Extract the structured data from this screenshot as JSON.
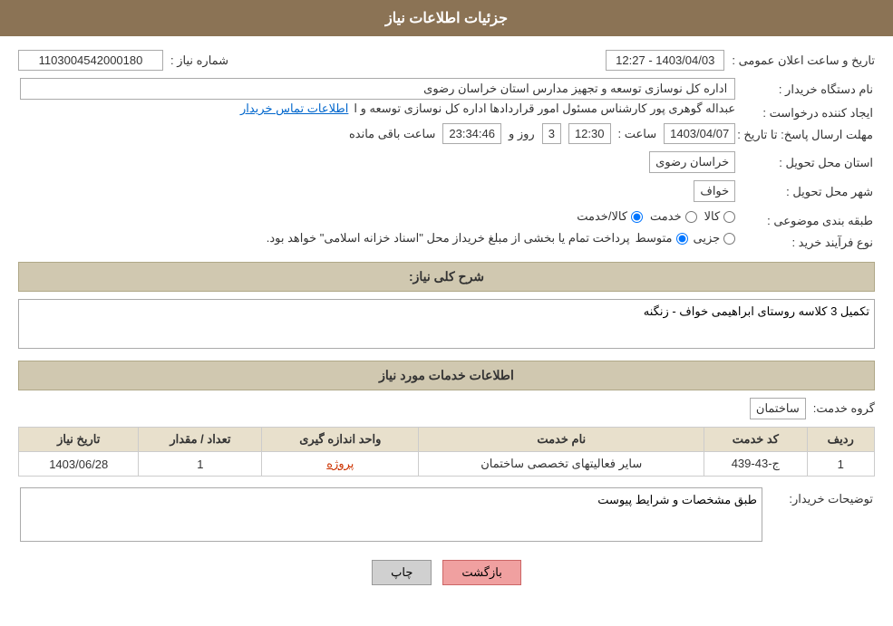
{
  "header": {
    "title": "جزئیات اطلاعات نیاز"
  },
  "fields": {
    "shomara_label": "شماره نیاز :",
    "shomara_value": "1103004542000180",
    "tarikh_label": "تاریخ و ساعت اعلان عمومی :",
    "tarikh_value": "1403/04/03 - 12:27",
    "nam_label": "نام دستگاه خریدار :",
    "nam_value": "اداره کل نوسازی  توسعه و تجهیز مدارس استان خراسان رضوی",
    "ejad_label": "ایجاد کننده درخواست :",
    "ejad_value": "عبداله گوهری پور کارشناس مسئول امور قراردادها  اداره کل نوسازی  توسعه و ا",
    "ejad_link": "اطلاعات تماس خریدار",
    "mohlat_label": "مهلت ارسال پاسخ: تا تاریخ :",
    "date_val": "1403/04/07",
    "saat_label": "ساعت :",
    "saat_val": "12:30",
    "roz_label": "روز و",
    "baqimande_val": "3",
    "saat_mande_val": "23:34:46",
    "saat_mande_label": "ساعت باقی مانده",
    "ostan_label": "استان محل تحویل :",
    "ostan_val": "خراسان رضوی",
    "shahr_label": "شهر محل تحویل :",
    "shahr_val": "خواف",
    "tabaqe_label": "طبقه بندی موضوعی :",
    "tabaqe_kala": "کالا",
    "tabaqe_khadamat": "خدمت",
    "tabaqe_kala_khadamat": "کالا/خدمت",
    "ferayand_label": "نوع فرآیند خرید :",
    "ferayand_jozi": "جزیی",
    "ferayand_motovaset": "متوسط",
    "ferayand_desc": "پرداخت تمام یا بخشی از مبلغ خریداز محل \"اسناد خزانه اسلامی\" خواهد بود.",
    "sharh_label": "شرح کلی نیاز:",
    "sharh_value": "تکمیل 3 کلاسه روستای ابراهیمی خواف - زنگنه",
    "services_header": "اطلاعات خدمات مورد نیاز",
    "gorohe_label": "گروه خدمت:",
    "gorohe_val": "ساختمان",
    "table_headers": [
      "ردیف",
      "کد خدمت",
      "نام خدمت",
      "واحد اندازه گیری",
      "تعداد / مقدار",
      "تاریخ نیاز"
    ],
    "table_rows": [
      {
        "radif": "1",
        "kod": "ج-43-439",
        "name": "سایر فعالیتهای تخصصی ساختمان",
        "vahad": "پروژه",
        "tedad": "1",
        "tarikh": "1403/06/28"
      }
    ],
    "tawzih_label": "توضیحات خریدار:",
    "tawzih_value": "طبق مشخصات و شرایط پیوست"
  },
  "buttons": {
    "chap": "چاپ",
    "bazgasht": "بازگشت"
  }
}
